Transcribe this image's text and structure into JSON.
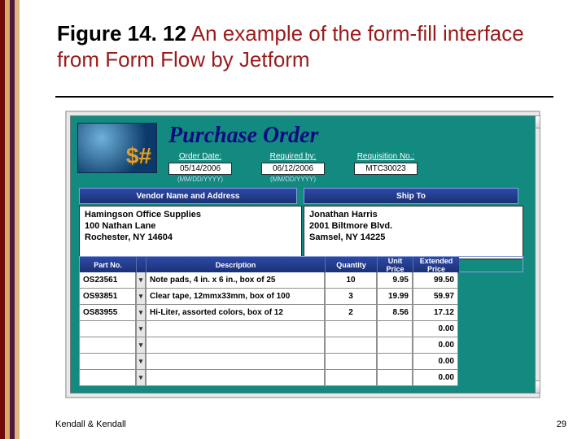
{
  "title_bold": "Figure 14. 12",
  "title_rest": " An example of the form-fill interface from Form Flow by Jetform",
  "footer": {
    "left": "Kendall & Kendall",
    "right": "29"
  },
  "po": {
    "heading": "Purchase Order",
    "labels": {
      "order_date": "Order Date:",
      "required_by": "Required by:",
      "req_no": "Requisition No.:",
      "order_date_val": "05/14/2006",
      "required_by_val": "06/12/2006",
      "req_no_val": "MTC30023",
      "date_hint": "(MM/DD/YYYY)"
    },
    "sections": {
      "vendor_hdr": "Vendor Name and Address",
      "ship_hdr": "Ship To"
    },
    "vendor": {
      "l1": "Hamingson Office Supplies",
      "l2": "100 Nathan Lane",
      "l3": "Rochester, NY  14604"
    },
    "ship": {
      "l1": "Jonathan Harris",
      "l2": "2001 Biltmore Blvd.",
      "l3": "Samsel, NY 14225"
    },
    "cols": {
      "part": "Part No.",
      "spacer": "",
      "desc": "Description",
      "qty": "Quantity",
      "unit": "Unit Price",
      "ext": "Extended Price"
    },
    "rows": [
      {
        "part": "OS23561",
        "desc": "Note pads, 4 in. x 6 in., box of 25",
        "qty": "10",
        "unit": "9.95",
        "ext": "99.50"
      },
      {
        "part": "OS93851",
        "desc": "Clear tape, 12mmx33mm, box of 100",
        "qty": "3",
        "unit": "19.99",
        "ext": "59.97"
      },
      {
        "part": "OS83955",
        "desc": "Hi-Liter, assorted colors, box of 12",
        "qty": "2",
        "unit": "8.56",
        "ext": "17.12"
      },
      {
        "part": "",
        "desc": "",
        "qty": "",
        "unit": "",
        "ext": "0.00"
      },
      {
        "part": "",
        "desc": "",
        "qty": "",
        "unit": "",
        "ext": "0.00"
      },
      {
        "part": "",
        "desc": "",
        "qty": "",
        "unit": "",
        "ext": "0.00"
      },
      {
        "part": "",
        "desc": "",
        "qty": "",
        "unit": "",
        "ext": "0.00"
      }
    ]
  }
}
